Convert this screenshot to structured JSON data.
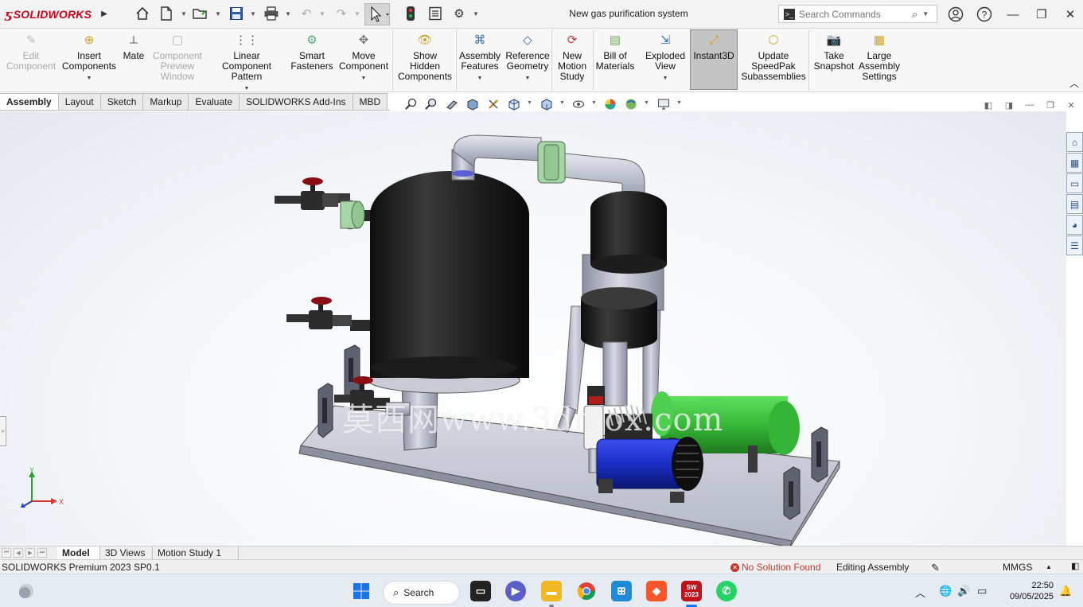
{
  "app": {
    "logo_text": "SOLIDWORKS",
    "document_title": "New gas purification system"
  },
  "search": {
    "placeholder": "Search Commands"
  },
  "ribbon": {
    "buttons": [
      {
        "label1": "Edit",
        "label2": "Component",
        "label3": "",
        "disabled": true,
        "has_dropdown": false,
        "icon": "edit-component-icon"
      },
      {
        "label1": "Insert",
        "label2": "Components",
        "label3": "",
        "disabled": false,
        "has_dropdown": true,
        "icon": "insert-components-icon"
      },
      {
        "label1": "Mate",
        "label2": "",
        "label3": "",
        "disabled": false,
        "has_dropdown": false,
        "icon": "mate-icon"
      },
      {
        "label1": "Component",
        "label2": "Preview",
        "label3": "Window",
        "disabled": true,
        "has_dropdown": false,
        "icon": "component-preview-icon"
      },
      {
        "label1": "Linear Component",
        "label2": "Pattern",
        "label3": "",
        "disabled": false,
        "has_dropdown": true,
        "icon": "linear-pattern-icon"
      },
      {
        "label1": "Smart",
        "label2": "Fasteners",
        "label3": "",
        "disabled": false,
        "has_dropdown": false,
        "icon": "smart-fasteners-icon"
      },
      {
        "label1": "Move",
        "label2": "Component",
        "label3": "",
        "disabled": false,
        "has_dropdown": true,
        "icon": "move-component-icon"
      },
      {
        "label1": "Show",
        "label2": "Hidden",
        "label3": "Components",
        "disabled": false,
        "has_dropdown": false,
        "icon": "show-hidden-icon"
      },
      {
        "label1": "Assembly",
        "label2": "Features",
        "label3": "",
        "disabled": false,
        "has_dropdown": true,
        "icon": "assembly-features-icon"
      },
      {
        "label1": "Reference",
        "label2": "Geometry",
        "label3": "",
        "disabled": false,
        "has_dropdown": true,
        "icon": "reference-geometry-icon"
      },
      {
        "label1": "New",
        "label2": "Motion",
        "label3": "Study",
        "disabled": false,
        "has_dropdown": false,
        "icon": "motion-study-icon"
      },
      {
        "label1": "Bill of",
        "label2": "Materials",
        "label3": "",
        "disabled": false,
        "has_dropdown": false,
        "icon": "bill-of-materials-icon"
      },
      {
        "label1": "Exploded",
        "label2": "View",
        "label3": "",
        "disabled": false,
        "has_dropdown": true,
        "icon": "exploded-view-icon"
      },
      {
        "label1": "Instant3D",
        "label2": "",
        "label3": "",
        "disabled": false,
        "has_dropdown": false,
        "icon": "instant3d-icon"
      },
      {
        "label1": "Update",
        "label2": "SpeedPak",
        "label3": "Subassemblies",
        "disabled": false,
        "has_dropdown": false,
        "icon": "speedpak-icon"
      },
      {
        "label1": "Take",
        "label2": "Snapshot",
        "label3": "",
        "disabled": false,
        "has_dropdown": false,
        "icon": "snapshot-icon"
      },
      {
        "label1": "Large",
        "label2": "Assembly",
        "label3": "Settings",
        "disabled": false,
        "has_dropdown": false,
        "icon": "large-assembly-icon"
      }
    ]
  },
  "command_tabs": [
    "Assembly",
    "Layout",
    "Sketch",
    "Markup",
    "Evaluate",
    "SOLIDWORKS Add-Ins",
    "MBD"
  ],
  "active_command_tab": "Assembly",
  "watermark": "莫西网www.3dmox.com",
  "triad": {
    "x": "X",
    "y": "Y",
    "z": "Z"
  },
  "bottom_tabs": [
    "Model",
    "3D Views",
    "Motion Study 1"
  ],
  "active_bottom_tab": "Model",
  "status": {
    "product": "SOLIDWORKS Premium 2023 SP0.1",
    "solution": "No Solution Found",
    "mode": "Editing Assembly",
    "units": "MMGS"
  },
  "taskbar": {
    "search_label": "Search",
    "sw_badge": "2023",
    "time": "22:50",
    "date": "09/05/2025"
  },
  "colors": {
    "brand_red": "#d0021b",
    "tank_dark": "#202020",
    "tank_green": "#3ec43e",
    "motor_blue": "#1b2ec4",
    "baseplate": "#c7c9d6",
    "valve_red": "#8a0f14",
    "coupling_green": "#a6d6a6"
  }
}
